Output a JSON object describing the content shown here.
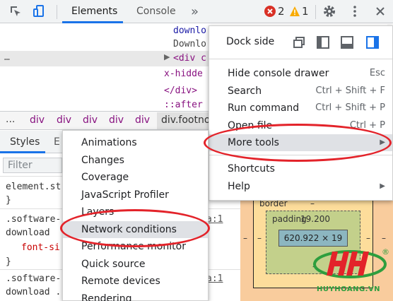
{
  "toolbar": {
    "tabs": [
      "Elements",
      "Console"
    ],
    "more_tabs": "»",
    "errors": "2",
    "warnings": "1"
  },
  "dom": {
    "line1": "downlo",
    "line2": "Downlo",
    "line3_tag": "<div c",
    "line4": "x-hidde",
    "line5": "</div>",
    "line6": "::after"
  },
  "breadcrumb": [
    "...",
    "div",
    "div",
    "div",
    "div",
    "div",
    "div.footno"
  ],
  "styles": {
    "tabs": [
      "Styles",
      "E"
    ],
    "filter_placeholder": "Filter",
    "rule1_selector": "element.st",
    "rule1_close": "}",
    "rule2_selector": ".software-",
    "rule2_line2": "download",
    "rule2_prop": "font-si",
    "rule2_close": "}",
    "rule2_link": "a:1",
    "rule3_selector": ".software-",
    "rule3_line2": "download .",
    "rule3_link": "a:1"
  },
  "box_model": {
    "border_label": "border",
    "border_value": "–",
    "padding_label": "padding",
    "padding_value": "19.200",
    "content": "620.922 × 19",
    "dash": "–"
  },
  "main_menu": {
    "dock_side_label": "Dock side",
    "items": [
      {
        "label": "Hide console drawer",
        "shortcut": "Esc"
      },
      {
        "label": "Search",
        "shortcut": "Ctrl + Shift + F"
      },
      {
        "label": "Run command",
        "shortcut": "Ctrl + Shift + P"
      },
      {
        "label": "Open file",
        "shortcut": "Ctrl + P"
      },
      {
        "label": "More tools",
        "shortcut": ""
      },
      {
        "label": "Shortcuts",
        "shortcut": ""
      },
      {
        "label": "Help",
        "shortcut": ""
      }
    ],
    "submenu_arrow": "▶"
  },
  "submenu": {
    "items": [
      "Animations",
      "Changes",
      "Coverage",
      "JavaScript Profiler",
      "Layers",
      "Network conditions",
      "Performance monitor",
      "Quick source",
      "Remote devices",
      "Rendering"
    ]
  },
  "watermark": {
    "logo_text": "HH",
    "registered": "®",
    "site": "HUYHOANG.VN"
  },
  "colors": {
    "accent": "#1a73e8",
    "error": "#d93025",
    "warning": "#f9ab00",
    "highlight_ellipse": "#e3232a",
    "watermark_red": "#e3232a",
    "watermark_green": "#2e9e3e"
  }
}
